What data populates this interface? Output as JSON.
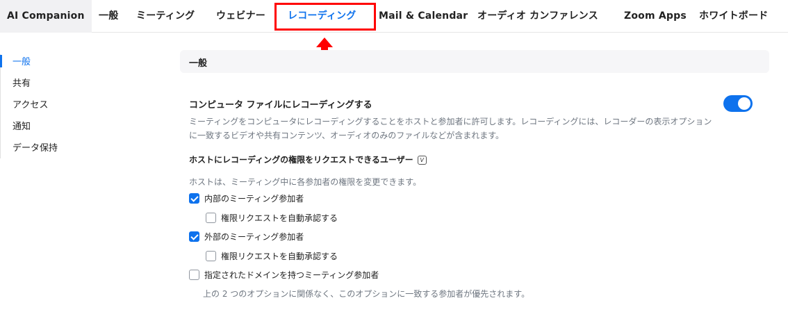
{
  "tabs": [
    {
      "label": "AI Companion"
    },
    {
      "label": "一般"
    },
    {
      "label": "ミーティング"
    },
    {
      "label": "ウェビナー"
    },
    {
      "label": "レコーディング"
    },
    {
      "label": "Mail & Calendar"
    },
    {
      "label": "オーディオ カンファレンス"
    },
    {
      "label": "Zoom Apps"
    },
    {
      "label": "ホワイトボード"
    }
  ],
  "active_tab": "レコーディング",
  "sidebar": {
    "items": [
      {
        "label": "一般",
        "active": true
      },
      {
        "label": "共有"
      },
      {
        "label": "アクセス"
      },
      {
        "label": "通知"
      },
      {
        "label": "データ保持"
      }
    ]
  },
  "section": {
    "title": "一般"
  },
  "setting": {
    "title": "コンピュータ ファイルにレコーディングする",
    "description": "ミーティングをコンピュータにレコーディングすることをホストと参加者に許可します。レコーディングには、レコーダーの表示オプションに一致するビデオや共有コンテンツ、オーディオのみのファイルなどが含まれます。",
    "enabled": true,
    "sub_title": "ホストにレコーディングの権限をリクエストできるユーザー",
    "sub_badge": "V",
    "sub_note": "ホストは、ミーティング中に各参加者の権限を変更できます。",
    "options": [
      {
        "label": "内部のミーティング参加者",
        "checked": true
      },
      {
        "label": "権限リクエストを自動承認する",
        "checked": false
      },
      {
        "label": "外部のミーティング参加者",
        "checked": true
      },
      {
        "label": "権限リクエストを自動承認する",
        "checked": false
      },
      {
        "label": "指定されたドメインを持つミーティング参加者",
        "checked": false
      }
    ],
    "footnote": "上の 2 つのオプションに関係なく、このオプションに一致する参加者が優先されます。"
  },
  "colors": {
    "accent": "#0e72ed",
    "highlight": "#ff0000"
  }
}
